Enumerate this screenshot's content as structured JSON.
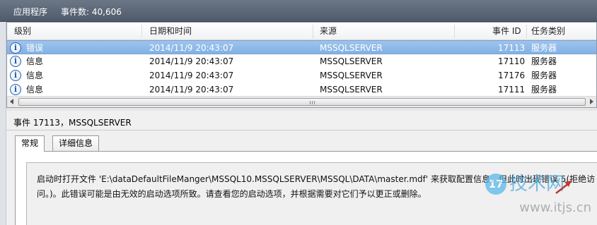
{
  "window": {
    "log_name": "应用程序",
    "event_count": "事件数: 40,606"
  },
  "columns": [
    "级别",
    "日期和时间",
    "来源",
    "事件 ID",
    "任务类别"
  ],
  "events": [
    {
      "level": "错误",
      "datetime": "2014/11/9 20:43:07",
      "source": "MSSQLSERVER",
      "event_id": "17113",
      "task_category": "服务器",
      "selected": true
    },
    {
      "level": "信息",
      "datetime": "2014/11/9 20:43:07",
      "source": "MSSQLSERVER",
      "event_id": "17110",
      "task_category": "服务器",
      "selected": false
    },
    {
      "level": "信息",
      "datetime": "2014/11/9 20:43:07",
      "source": "MSSQLSERVER",
      "event_id": "17176",
      "task_category": "服务器",
      "selected": false
    },
    {
      "level": "信息",
      "datetime": "2014/11/9 20:43:07",
      "source": "MSSQLSERVER",
      "event_id": "17111",
      "task_category": "服务器",
      "selected": false
    }
  ],
  "level_icon": "info-icon",
  "detail": {
    "title": "事件 17113，MSSQLSERVER",
    "tabs": [
      "常规",
      "详细信息"
    ],
    "active_tab": "常规",
    "message": "启动时打开文件 'E:\\dataDefaultFileManger\\MSSQL10.MSSQLSERVER\\MSSQL\\DATA\\master.mdf' 来获取配置信息，但此时出现错误 5(拒绝访问。)。此错误可能是由无效的启动选项所致。请查看您的启动选项，并根据需要对它们予以更正或删除。"
  },
  "watermark": {
    "logo_badge": "17",
    "logo_text": "技术网",
    "url": "www.itjs.cn"
  },
  "colors": {
    "title_bar": "#5d6878",
    "selected_row": "#8fbbe9",
    "watermark": "#4fa8dc"
  }
}
